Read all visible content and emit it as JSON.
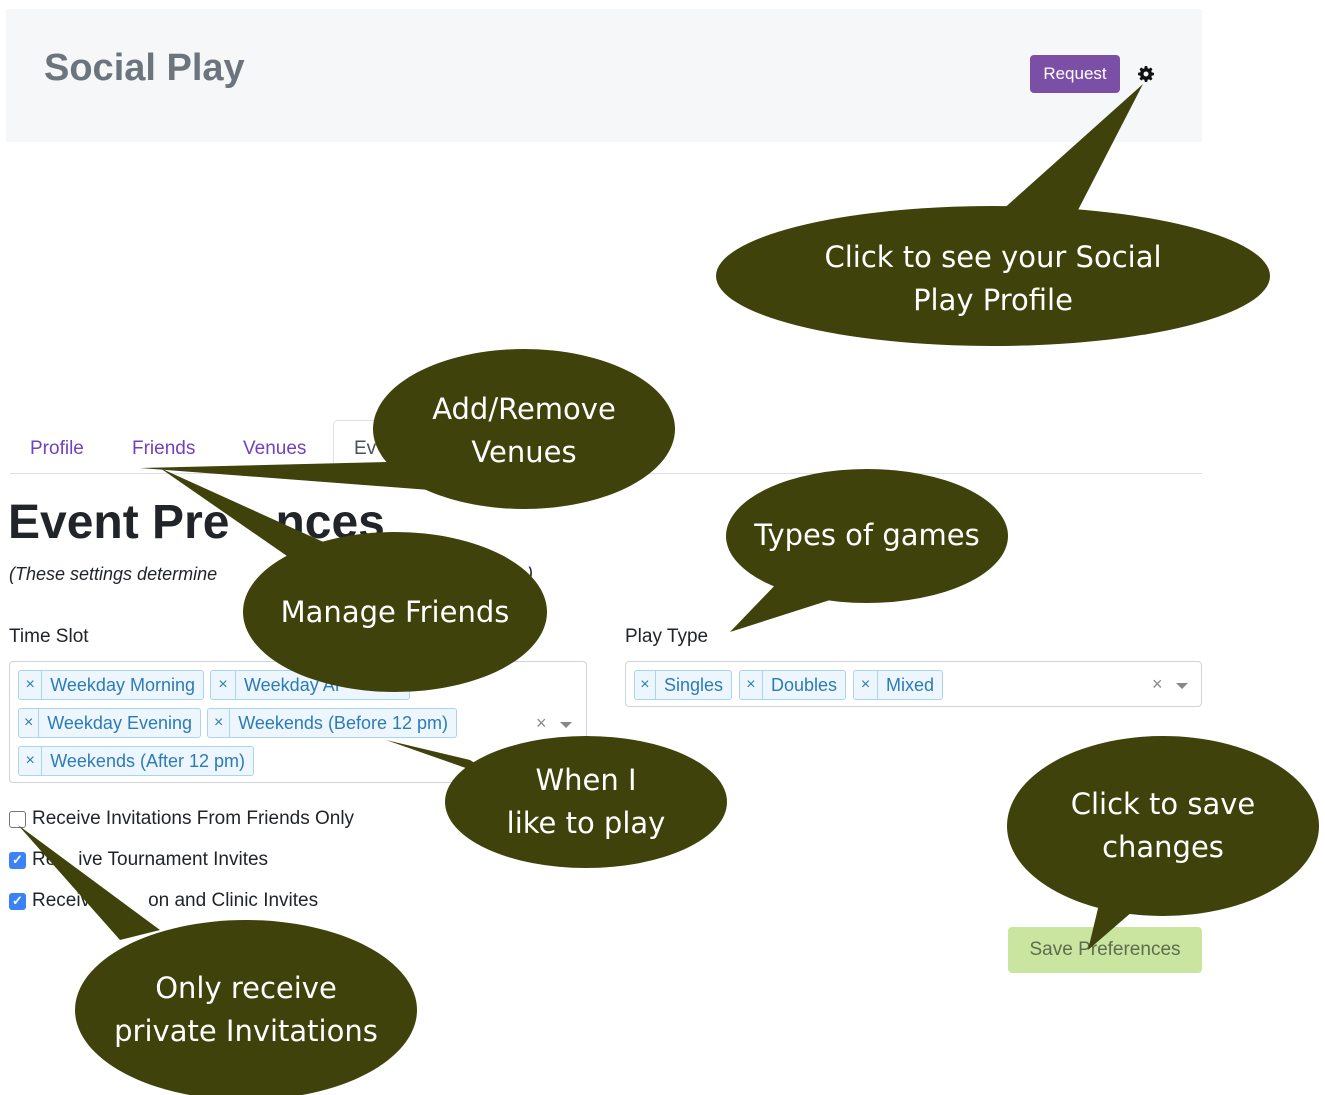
{
  "header": {
    "brand": "Social Play",
    "request_label": "Request",
    "settings_icon": "gear-icon"
  },
  "tabs": [
    {
      "label": "Profile",
      "active": false
    },
    {
      "label": "Friends",
      "active": false
    },
    {
      "label": "Venues",
      "active": false
    },
    {
      "label": "Ev",
      "active": true
    }
  ],
  "page": {
    "title": "Event Pre",
    "title_tail": "nces",
    "subtitle": "(These settings determine",
    "subtitle_tail": "ceive)"
  },
  "time_slot": {
    "label": "Time Slot",
    "chips": [
      "Weekday Morning",
      "Weekday Af",
      "Weekday Evening",
      "Weekends (Before 12 pm)",
      "Weekends (After 12 pm)"
    ]
  },
  "play_type": {
    "label": "Play Type",
    "chips": [
      "Singles",
      "Doubles",
      "Mixed"
    ]
  },
  "chip_remove_glyph": "×",
  "checkboxes": [
    {
      "label": "Receive Invitations From Friends Only",
      "checked": false
    },
    {
      "label": "Re",
      "tail": "ive Tournament Invites",
      "checked": true
    },
    {
      "label": "Receiv",
      "tail": "on and Clinic Invites",
      "checked": true
    }
  ],
  "save_label": "Save Preferences",
  "callouts": {
    "profile": [
      "Click to see your Social",
      "Play Profile"
    ],
    "venues": [
      "Add/Remove",
      "Venues"
    ],
    "games": [
      "Types of games"
    ],
    "friends": [
      "Manage Friends"
    ],
    "time": [
      "When I",
      "like to play"
    ],
    "save": [
      "Click to save",
      "changes"
    ],
    "private": [
      "Only receive",
      "private Invitations"
    ]
  },
  "colors": {
    "callout_fill": "#3f420b",
    "brand_purple": "#7c4fa6",
    "tab_link": "#6f42c1",
    "save_bg": "#c9e5a0"
  }
}
